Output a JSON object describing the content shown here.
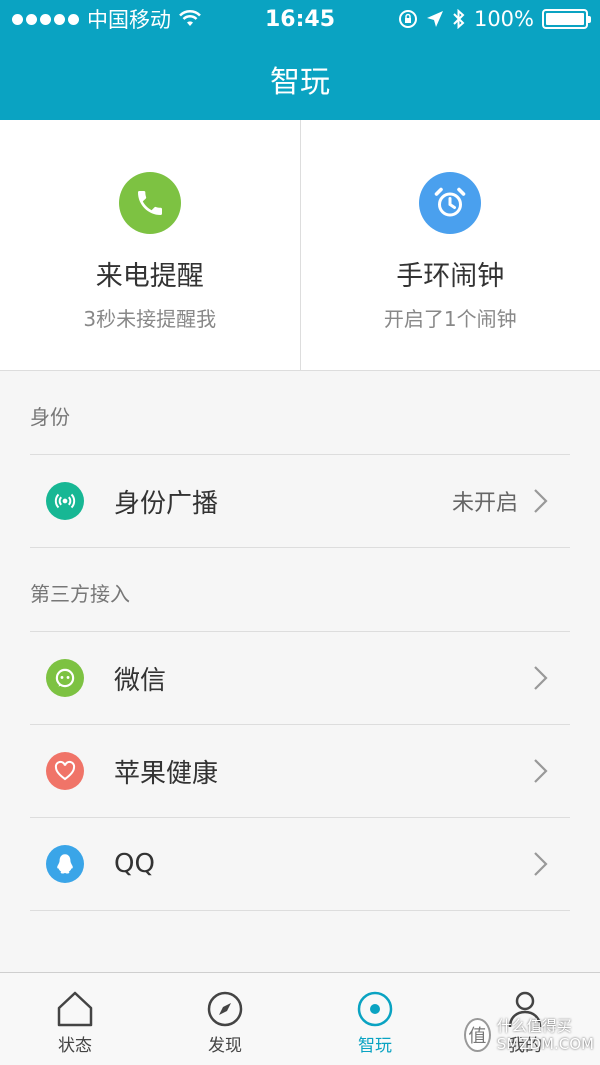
{
  "status_bar": {
    "carrier": "中国移动",
    "time": "16:45",
    "battery": "100%",
    "battery_level": 1.0
  },
  "nav": {
    "title": "智玩"
  },
  "quick_actions": [
    {
      "title": "来电提醒",
      "subtitle": "3秒未接提醒我",
      "icon": "phone-icon",
      "color": "#7dc242"
    },
    {
      "title": "手环闹钟",
      "subtitle": "开启了1个闹钟",
      "icon": "alarm-clock-icon",
      "color": "#4aa0ee"
    }
  ],
  "sections": {
    "identity": {
      "header": "身份",
      "items": [
        {
          "label": "身份广播",
          "value": "未开启",
          "icon": "broadcast-icon",
          "color": "#17b794"
        }
      ]
    },
    "third_party": {
      "header": "第三方接入",
      "items": [
        {
          "label": "微信",
          "icon": "wechat-icon",
          "color": "#7dc242"
        },
        {
          "label": "苹果健康",
          "icon": "heart-icon",
          "color": "#f07468"
        },
        {
          "label": "QQ",
          "icon": "qq-icon",
          "color": "#3aa5e8"
        }
      ]
    }
  },
  "tab_bar": {
    "tabs": [
      {
        "label": "状态",
        "icon": "home-icon"
      },
      {
        "label": "发现",
        "icon": "compass-icon"
      },
      {
        "label": "智玩",
        "icon": "target-icon",
        "active": true
      },
      {
        "label": "我的",
        "icon": "user-icon"
      }
    ],
    "active_color": "#0aa3c2"
  },
  "watermark": {
    "line1": "什么值得买",
    "line2": "SMZDM.COM",
    "badge": "值"
  }
}
